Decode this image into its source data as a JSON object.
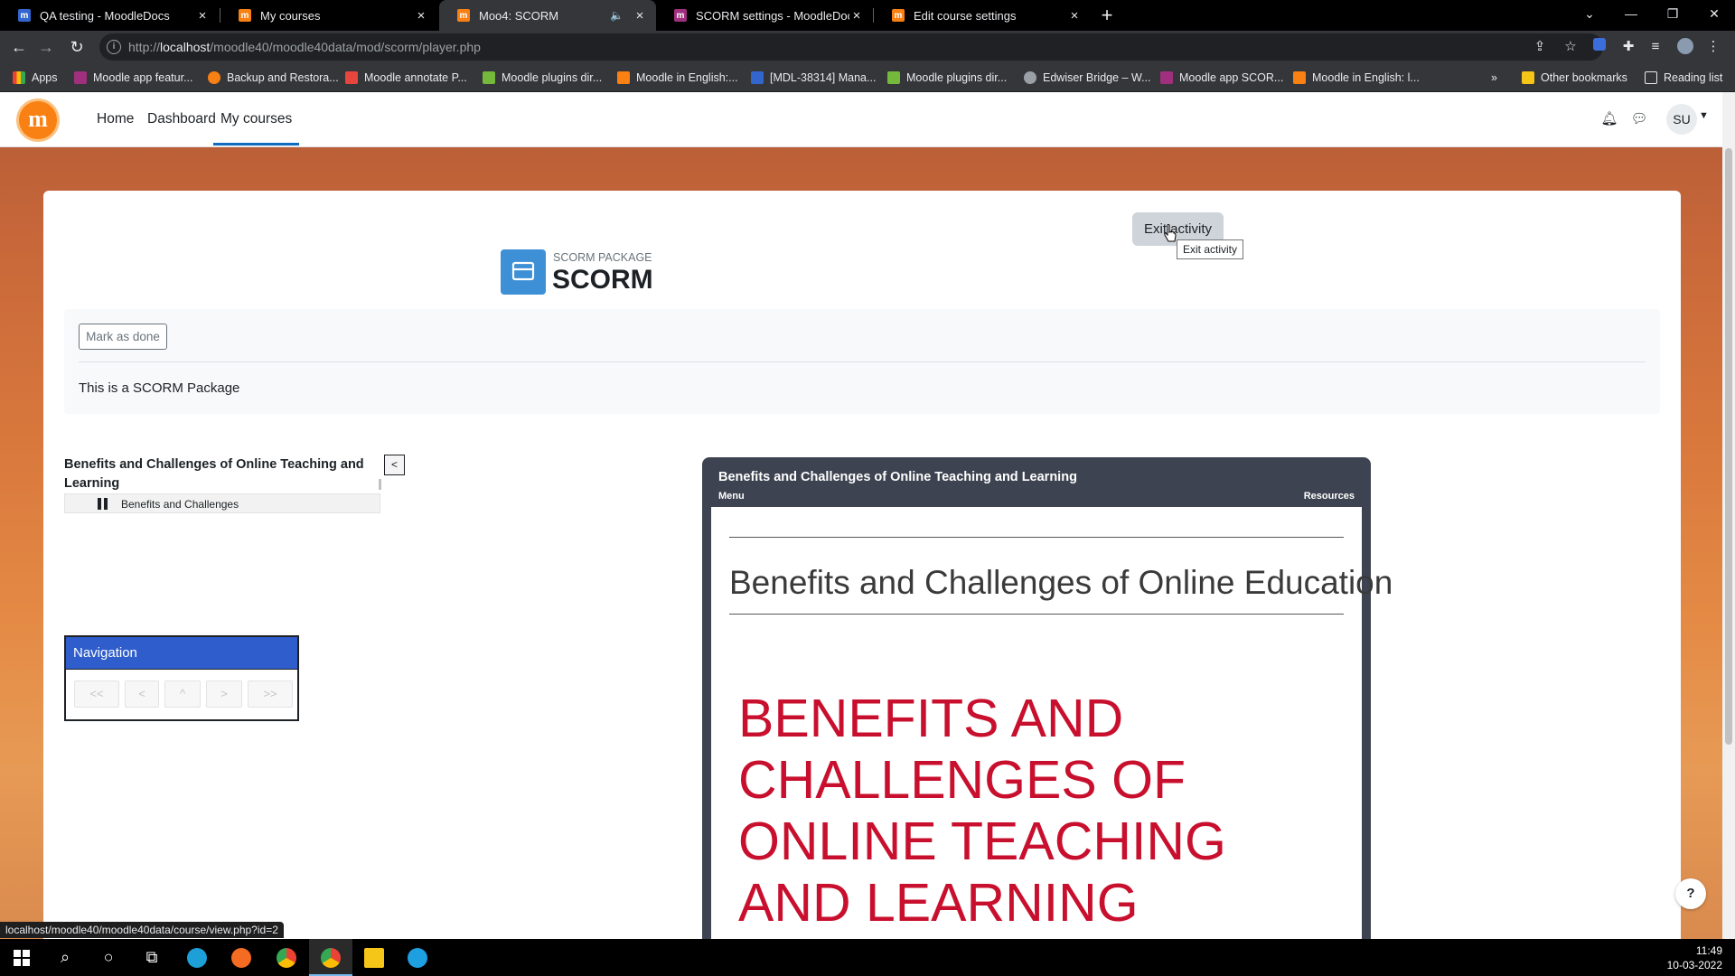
{
  "browser": {
    "tabs": [
      {
        "title": "QA testing - MoodleDocs",
        "active": false
      },
      {
        "title": "My courses",
        "active": false
      },
      {
        "title": "Moo4: SCORM",
        "active": true
      },
      {
        "title": "SCORM settings - MoodleDocs",
        "active": false
      },
      {
        "title": "Edit course settings",
        "active": false
      }
    ],
    "url_prefix": "http://",
    "url_host": "localhost",
    "url_path": "/moodle40/moodle40data/mod/scorm/player.php",
    "bookmarks": [
      "Apps",
      "Moodle app featur...",
      "Backup and Restora...",
      "Moodle annotate P...",
      "Moodle plugins dir...",
      "Moodle in English:...",
      "[MDL-38314] Mana...",
      "Moodle plugins dir...",
      "Edwiser Bridge – W...",
      "Moodle app SCOR...",
      "Moodle in English: l..."
    ],
    "other_bookmarks": "Other bookmarks",
    "reading_list": "Reading list",
    "status_url": "localhost/moodle40/moodle40data/course/view.php?id=2"
  },
  "moodle": {
    "nav": {
      "home": "Home",
      "dashboard": "Dashboard",
      "my_courses": "My courses"
    },
    "user_initials": "SU",
    "exit_button": "Exit activity",
    "exit_tooltip": "Exit activity",
    "package_label": "SCORM PACKAGE",
    "package_title": "SCORM",
    "mark_done": "Mark as done",
    "description": "This is a SCORM Package",
    "toc": {
      "title": "Benefits and Challenges of Online Teaching and Learning",
      "toggle": "<",
      "item": "Benefits and Challenges"
    },
    "navigation": {
      "title": "Navigation",
      "buttons": [
        "<<",
        "<",
        "^",
        ">",
        ">>"
      ]
    },
    "player": {
      "title": "Benefits and Challenges of Online Teaching and Learning",
      "menu": "Menu",
      "resources": "Resources",
      "slide_title": "Benefits and Challenges of Online Education",
      "slide_heading": "BENEFITS AND CHALLENGES OF ONLINE TEACHING AND LEARNING"
    },
    "help": "?"
  },
  "taskbar": {
    "time": "11:49",
    "date": "10-03-2022"
  },
  "colors": {
    "brand": "#f98012",
    "nav_header": "#2f5dcc",
    "slide_heading": "#c8102e",
    "player_frame": "#3d4350"
  }
}
